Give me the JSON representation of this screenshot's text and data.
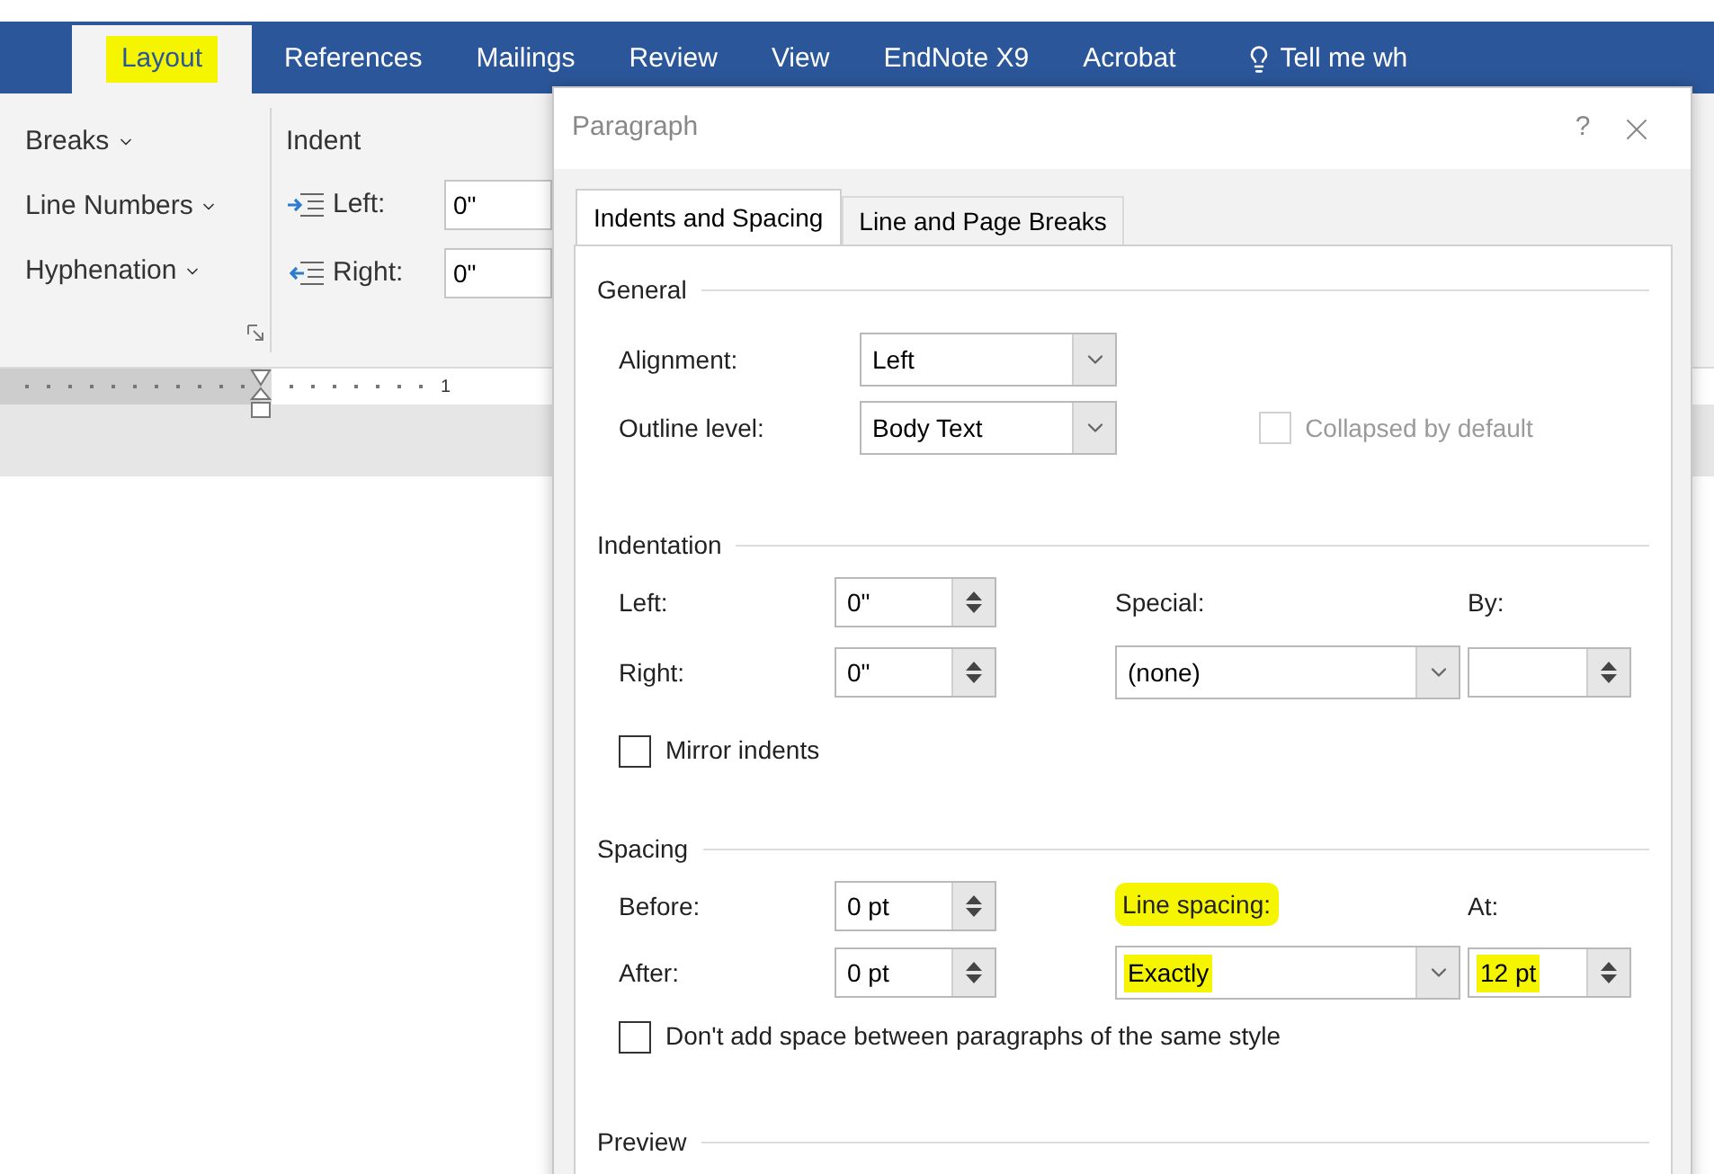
{
  "ribbon_tabs": [
    {
      "label": "Layout",
      "selected": true,
      "highlighted": true
    },
    {
      "label": "References",
      "selected": false,
      "highlighted": false
    },
    {
      "label": "Mailings",
      "selected": false,
      "highlighted": false
    },
    {
      "label": "Review",
      "selected": false,
      "highlighted": false
    },
    {
      "label": "View",
      "selected": false,
      "highlighted": false
    },
    {
      "label": "EndNote X9",
      "selected": false,
      "highlighted": false
    },
    {
      "label": "Acrobat",
      "selected": false,
      "highlighted": false
    }
  ],
  "tell_me": "Tell me wh",
  "page_setup": [
    "Breaks",
    "Line Numbers",
    "Hyphenation"
  ],
  "indent_group": {
    "title": "Indent",
    "fields": [
      {
        "label": "Left:",
        "value": "0\""
      },
      {
        "label": "Right:",
        "value": "0\""
      }
    ]
  },
  "ruler": {
    "number": "1"
  },
  "dialog": {
    "title": "Paragraph",
    "help": "?",
    "tabs": [
      {
        "label": "Indents and Spacing",
        "selected": true
      },
      {
        "label": "Line and Page Breaks",
        "selected": false
      }
    ],
    "general": {
      "title": "General",
      "alignment": {
        "label": "Alignment:",
        "value": "Left"
      },
      "outline": {
        "label": "Outline level:",
        "value": "Body Text"
      },
      "collapsed": {
        "label": "Collapsed by default",
        "checked": false,
        "disabled": true
      }
    },
    "indentation": {
      "title": "Indentation",
      "left": {
        "label": "Left:",
        "value": "0\""
      },
      "right": {
        "label": "Right:",
        "value": "0\""
      },
      "special": {
        "label": "Special:",
        "value": "(none)"
      },
      "by": {
        "label": "By:"
      },
      "mirror": {
        "label": "Mirror indents",
        "checked": false
      }
    },
    "spacing": {
      "title": "Spacing",
      "before": {
        "label": "Before:",
        "value": "0 pt"
      },
      "after": {
        "label": "After:",
        "value": "0 pt"
      },
      "line_spacing": {
        "label": "Line spacing:",
        "label_highlighted": true,
        "value": "Exactly",
        "value_highlighted": true
      },
      "at": {
        "label": "At:",
        "value": "12 pt",
        "value_highlighted": true
      },
      "dont_add": {
        "label": "Don't add space between paragraphs of the same style",
        "checked": false
      }
    },
    "preview_title": "Preview"
  }
}
